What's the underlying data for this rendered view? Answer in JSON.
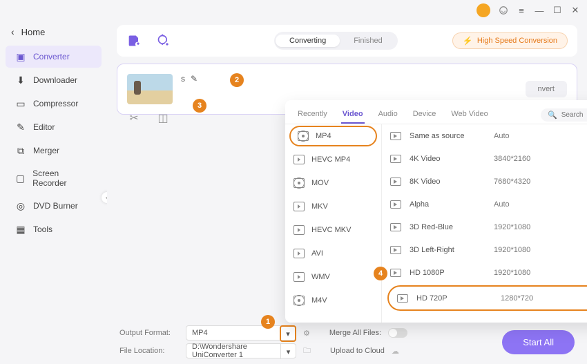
{
  "window": {
    "avatar_initial": ""
  },
  "sidebar": {
    "back_label": "Home",
    "items": [
      {
        "label": "Converter",
        "icon": "converter"
      },
      {
        "label": "Downloader",
        "icon": "downloader"
      },
      {
        "label": "Compressor",
        "icon": "compressor"
      },
      {
        "label": "Editor",
        "icon": "editor"
      },
      {
        "label": "Merger",
        "icon": "merger"
      },
      {
        "label": "Screen Recorder",
        "icon": "screen-recorder"
      },
      {
        "label": "DVD Burner",
        "icon": "dvd-burner"
      },
      {
        "label": "Tools",
        "icon": "tools"
      }
    ]
  },
  "toolbar": {
    "segment": {
      "converting": "Converting",
      "finished": "Finished"
    },
    "speed": "High Speed Conversion"
  },
  "file": {
    "title_partial": "s",
    "convert_label": "nvert"
  },
  "dropdown": {
    "tabs": {
      "recently": "Recently",
      "video": "Video",
      "audio": "Audio",
      "device": "Device",
      "web": "Web Video"
    },
    "search_placeholder": "Search",
    "formats": [
      {
        "label": "MP4",
        "ico": "target"
      },
      {
        "label": "HEVC MP4",
        "ico": "hevc"
      },
      {
        "label": "MOV",
        "ico": "target"
      },
      {
        "label": "MKV",
        "ico": "film"
      },
      {
        "label": "HEVC MKV",
        "ico": "hevc"
      },
      {
        "label": "AVI",
        "ico": "film"
      },
      {
        "label": "WMV",
        "ico": "film"
      },
      {
        "label": "M4V",
        "ico": "target"
      }
    ],
    "resolutions": [
      {
        "label": "Same as source",
        "dim": "Auto"
      },
      {
        "label": "4K Video",
        "dim": "3840*2160"
      },
      {
        "label": "8K Video",
        "dim": "7680*4320"
      },
      {
        "label": "Alpha",
        "dim": "Auto"
      },
      {
        "label": "3D Red-Blue",
        "dim": "1920*1080"
      },
      {
        "label": "3D Left-Right",
        "dim": "1920*1080"
      },
      {
        "label": "HD 1080P",
        "dim": "1920*1080"
      },
      {
        "label": "HD 720P",
        "dim": "1280*720"
      }
    ]
  },
  "footer": {
    "output_label": "Output Format:",
    "output_value": "MP4",
    "location_label": "File Location:",
    "location_value": "D:\\Wondershare UniConverter 1",
    "merge_label": "Merge All Files:",
    "upload_label": "Upload to Cloud"
  },
  "start_all": "Start All",
  "callouts": {
    "c1": "1",
    "c2": "2",
    "c3": "3",
    "c4": "4"
  }
}
